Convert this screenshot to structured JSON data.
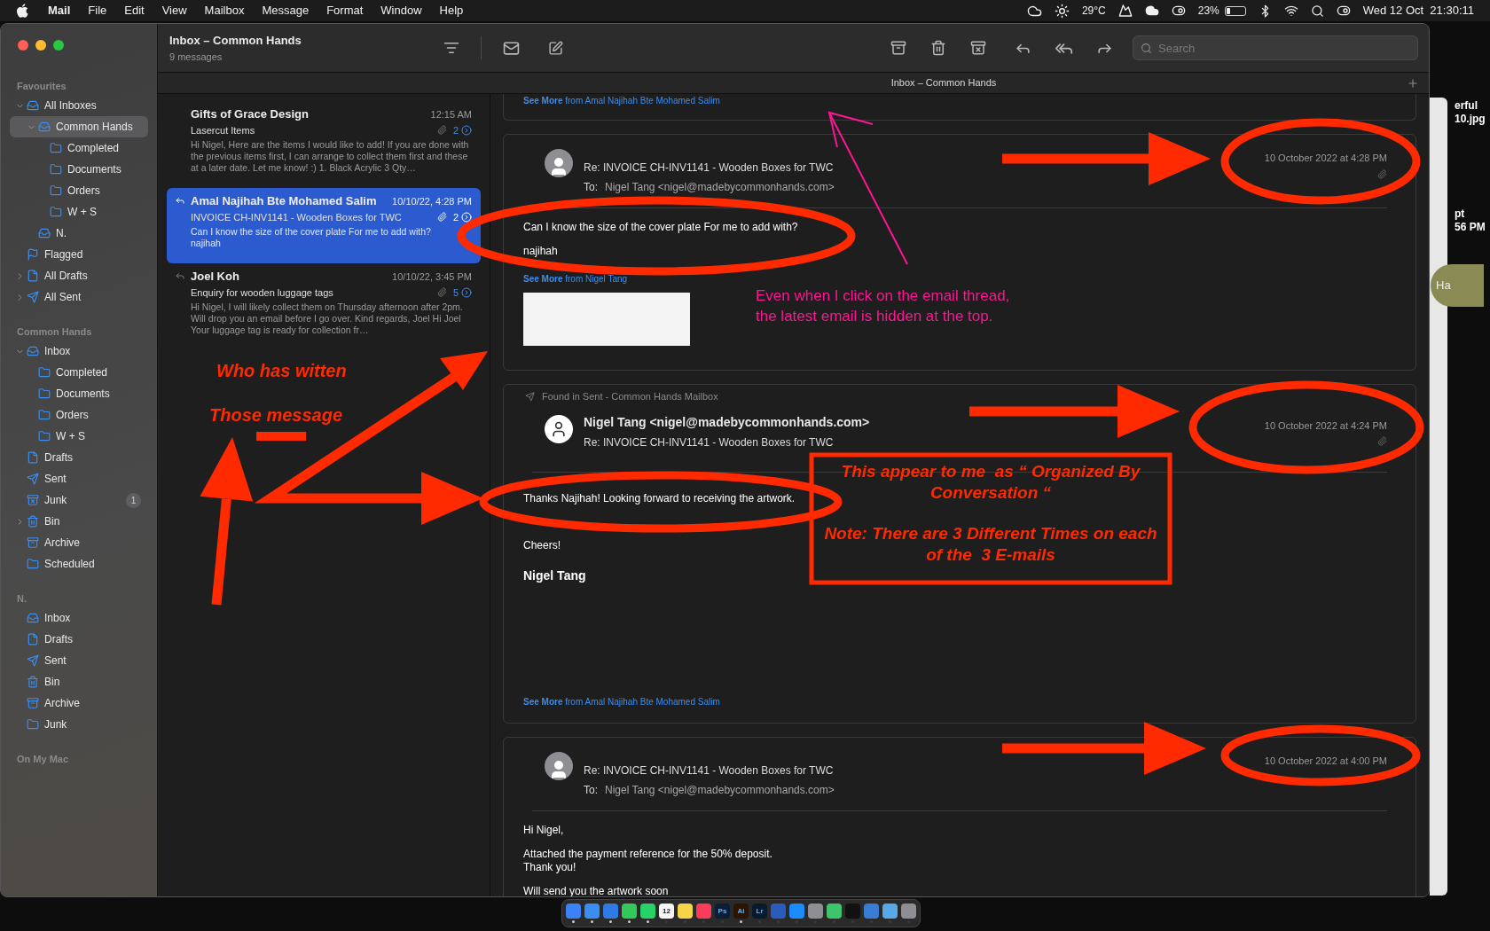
{
  "menu_bar": {
    "app": "Mail",
    "menus": [
      "File",
      "Edit",
      "View",
      "Mailbox",
      "Message",
      "Format",
      "Window",
      "Help"
    ],
    "temperature": "29°C",
    "battery": "23%",
    "clock": "Wed 12 Oct  21:30:11"
  },
  "toolbar": {
    "title": "Inbox – Common Hands",
    "subtitle": "9 messages",
    "search": {
      "placeholder": "Search"
    }
  },
  "tab_bar": {
    "title": "Inbox – Common Hands"
  },
  "sidebar": {
    "sections": [
      {
        "title": "Favourites",
        "items": [
          {
            "label": "All Inboxes",
            "kind": "inbox",
            "expanded": true,
            "selected": false,
            "children": [
              {
                "label": "Common Hands",
                "kind": "inbox",
                "expanded": true,
                "selected": true,
                "children": [
                  {
                    "label": "Completed",
                    "kind": "folder",
                    "selected": false
                  },
                  {
                    "label": "Documents",
                    "kind": "folder",
                    "selected": false
                  },
                  {
                    "label": "Orders",
                    "kind": "folder",
                    "selected": false
                  },
                  {
                    "label": "W + S",
                    "kind": "folder",
                    "selected": false
                  }
                ]
              },
              {
                "label": "N.",
                "kind": "inbox",
                "selected": false
              }
            ]
          },
          {
            "label": "Flagged",
            "kind": "flag",
            "selected": false
          },
          {
            "label": "All Drafts",
            "kind": "draft",
            "expanded": false,
            "selected": false
          },
          {
            "label": "All Sent",
            "kind": "sent",
            "expanded": false,
            "selected": false
          }
        ]
      },
      {
        "title": "Common Hands",
        "items": [
          {
            "label": "Inbox",
            "kind": "inbox",
            "expanded": true,
            "selected": false,
            "children": [
              {
                "label": "Completed",
                "kind": "folder",
                "selected": false
              },
              {
                "label": "Documents",
                "kind": "folder",
                "selected": false
              },
              {
                "label": "Orders",
                "kind": "folder",
                "selected": false
              },
              {
                "label": "W + S",
                "kind": "folder",
                "selected": false
              }
            ]
          },
          {
            "label": "Drafts",
            "kind": "draft",
            "selected": false
          },
          {
            "label": "Sent",
            "kind": "sent",
            "selected": false
          },
          {
            "label": "Junk",
            "kind": "junk",
            "selected": false,
            "badge": "1"
          },
          {
            "label": "Bin",
            "kind": "bin",
            "expanded": false,
            "selected": false
          },
          {
            "label": "Archive",
            "kind": "archive",
            "selected": false
          },
          {
            "label": "Scheduled",
            "kind": "folder",
            "selected": false
          }
        ]
      },
      {
        "title": "N.",
        "items": [
          {
            "label": "Inbox",
            "kind": "inbox",
            "selected": false
          },
          {
            "label": "Drafts",
            "kind": "draft",
            "selected": false
          },
          {
            "label": "Sent",
            "kind": "sent",
            "selected": false
          },
          {
            "label": "Bin",
            "kind": "bin",
            "selected": false
          },
          {
            "label": "Archive",
            "kind": "archive",
            "selected": false
          },
          {
            "label": "Junk",
            "kind": "folder",
            "selected": false
          }
        ]
      },
      {
        "title": "On My Mac"
      }
    ]
  },
  "message_list": [
    {
      "sender": "Gifts of Grace Design",
      "date": "12:15 AM",
      "subject": "Lasercut Items",
      "preview": "Hi Nigel, Here are the items I would like to add! If you are done with the previous items first, I can arrange to collect them first and these at a later date. Let me know! :) 1. Black Acrylic 3 Qty…",
      "count": "2",
      "replied": false,
      "selected": false
    },
    {
      "sender": "Amal Najihah Bte Mohamed Salim",
      "date": "10/10/22, 4:28 PM",
      "subject": "INVOICE CH-INV1141 - Wooden Boxes for TWC",
      "preview": "Can I know the size of the cover plate For me to add with? najihah",
      "count": "2",
      "replied": true,
      "selected": true
    },
    {
      "sender": "Joel Koh",
      "date": "10/10/22, 3:45 PM",
      "subject": "Enquiry for wooden luggage tags",
      "preview": "Hi Nigel, I will likely collect them on Thursday afternoon after 2pm. Will drop you an email before I go over. Kind regards, Joel Hi Joel Your luggage tag is ready for collection fr…",
      "count": "5",
      "replied": true,
      "selected": false
    }
  ],
  "thread": [
    {
      "kind": "tail",
      "see_more": "See More",
      "see_more_from": "from Amal Najihah Bte Mohamed Salim"
    },
    {
      "kind": "received",
      "subject": "Re: INVOICE CH-INV1141 - Wooden Boxes for TWC",
      "to_label": "To:",
      "to": "Nigel Tang <nigel@madebycommonhands.com>",
      "date": "10 October 2022 at 4:28 PM",
      "attachment": true,
      "paragraphs": [
        [
          "Can I know the size of the cover plate For me to add with?"
        ],
        [
          "najihah"
        ]
      ],
      "see_more": "See More",
      "see_more_from": "from Nigel Tang",
      "signature_image": true
    },
    {
      "kind": "sent",
      "found_in": "Found in Sent - Common Hands Mailbox",
      "sender": "Nigel Tang <nigel@madebycommonhands.com>",
      "subject": "Re: INVOICE CH-INV1141 - Wooden Boxes for TWC",
      "date": "10 October 2022 at 4:24 PM",
      "attachment": true,
      "paragraphs": [
        [
          "Thanks Najihah! Looking forward to receiving the artwork."
        ],
        [
          "Cheers!"
        ]
      ],
      "signature_name": "Nigel Tang",
      "see_more": "See More",
      "see_more_from": "from Amal Najihah Bte Mohamed Salim"
    },
    {
      "kind": "received",
      "subject": "Re: INVOICE CH-INV1141 - Wooden Boxes for TWC",
      "to_label": "To:",
      "to": "Nigel Tang <nigel@madebycommonhands.com>",
      "date": "10 October 2022 at 4:00 PM",
      "attachment": false,
      "paragraphs": [
        [
          "Hi Nigel,"
        ],
        [
          "Attached the payment reference for the 50% deposit.",
          "Thank you!"
        ],
        [
          "Will send you the artwork soon"
        ]
      ]
    }
  ],
  "desktop_labels": [
    "erful",
    "10.jpg",
    "pt",
    "56 PM",
    "Ha"
  ],
  "annotations": [
    {
      "text": "Who has witten",
      "color": "#ff2a00"
    },
    {
      "text": "Those message",
      "color": "#ff2a00"
    },
    {
      "text": "Even when I click on the email thread, the latest email is hidden at the top.",
      "color": "#ff1493"
    },
    {
      "text": "This appear to me  as “ Organized By Conversation “",
      "color": "#ff2a00"
    },
    {
      "text": "Note: There are 3 Different Times on each of the  3 E-mails",
      "color": "#ff2a00"
    }
  ],
  "dock": [
    {
      "color": "#3b82f6",
      "running": true
    },
    {
      "color": "#3b8ef0",
      "running": true
    },
    {
      "color": "#2f7ae5",
      "running": true
    },
    {
      "color": "#34c759",
      "running": true
    },
    {
      "color": "#25d366",
      "running": true
    },
    {
      "color": "#f5f5f5",
      "label": "12",
      "running": false
    },
    {
      "color": "#f5d547",
      "running": false
    },
    {
      "color": "#fa3c5a",
      "running": false
    },
    {
      "color": "#0b1e36",
      "label": "Ps",
      "running": false
    },
    {
      "color": "#2b1400",
      "label": "Ai",
      "running": true
    },
    {
      "color": "#0a1a2e",
      "label": "Lr",
      "running": false
    },
    {
      "color": "#2b5bbd",
      "running": false
    },
    {
      "color": "#1a8cff",
      "running": false
    },
    {
      "color": "#8e8e93",
      "running": false
    },
    {
      "color": "#3ec46d",
      "running": false
    },
    {
      "color": "#111111",
      "running": false
    },
    {
      "color": "#3a7bd5",
      "running": false
    },
    {
      "color": "#5aa9e6",
      "running": false
    },
    {
      "color": "#8e8e93",
      "running": false
    }
  ]
}
